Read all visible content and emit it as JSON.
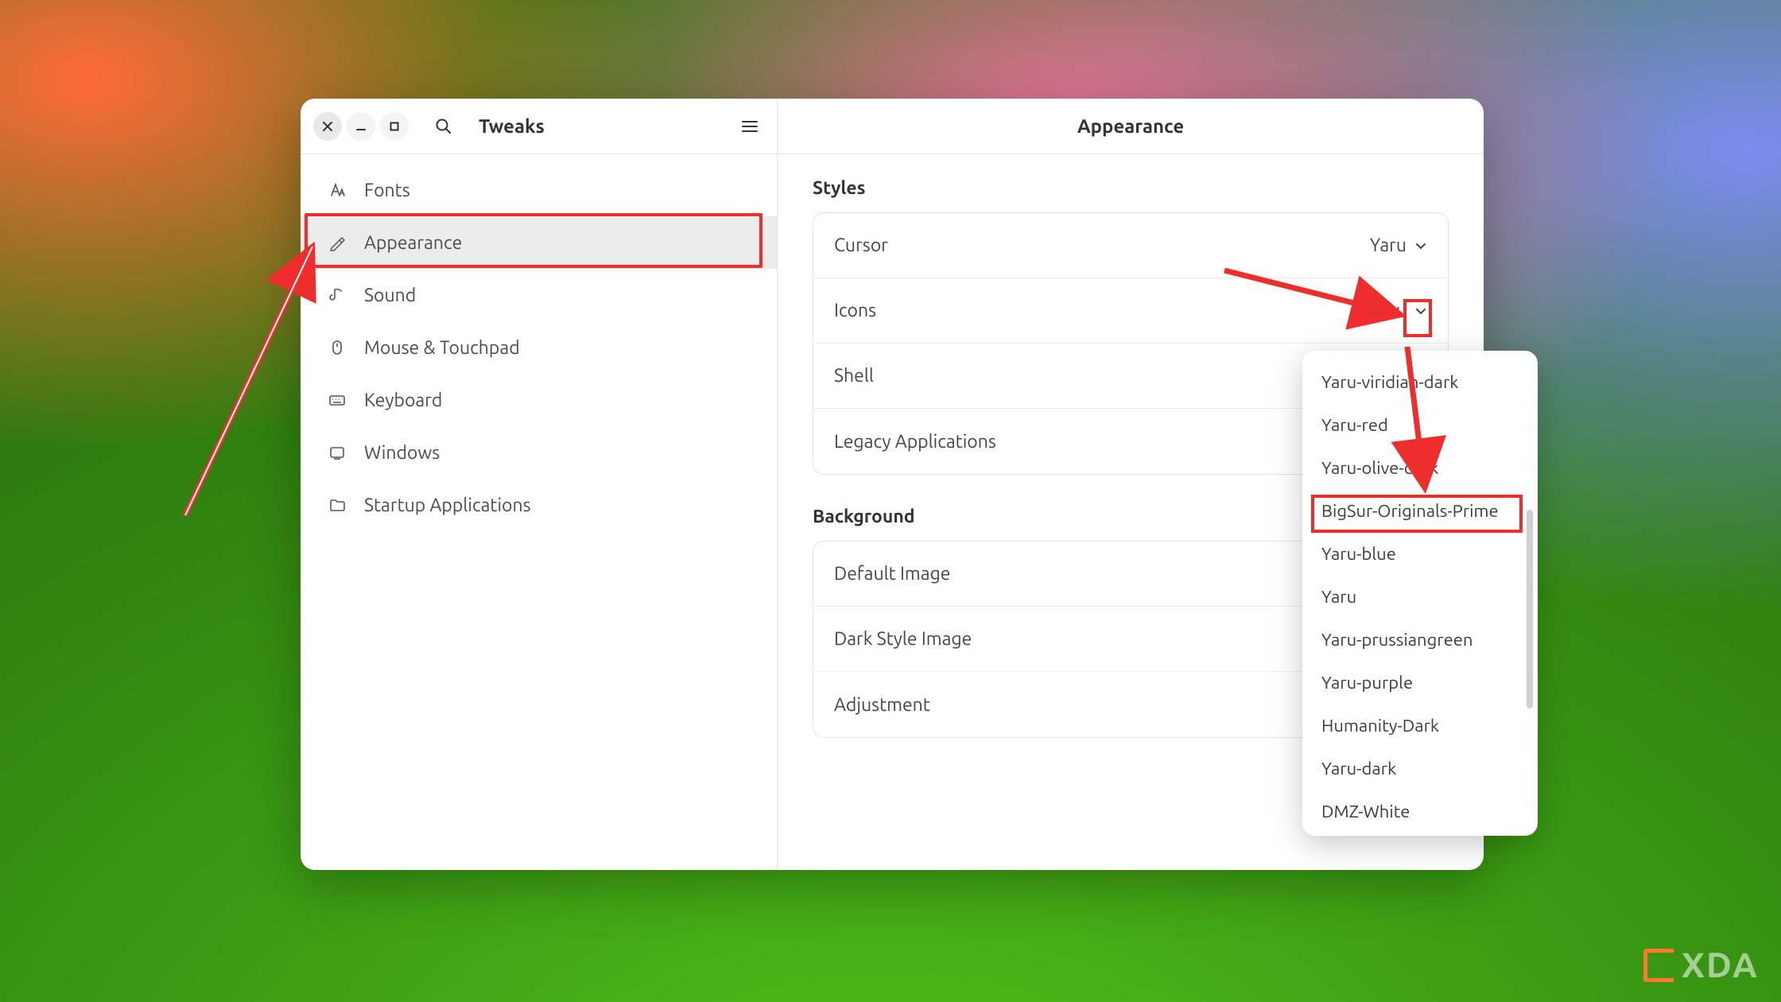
{
  "app_title": "Tweaks",
  "content_title": "Appearance",
  "sidebar": {
    "items": [
      {
        "label": "Fonts"
      },
      {
        "label": "Appearance"
      },
      {
        "label": "Sound"
      },
      {
        "label": "Mouse & Touchpad"
      },
      {
        "label": "Keyboard"
      },
      {
        "label": "Windows"
      },
      {
        "label": "Startup Applications"
      }
    ],
    "selected_index": 1
  },
  "sections": {
    "styles": {
      "title": "Styles",
      "rows": [
        {
          "label": "Cursor",
          "value": "Yaru"
        },
        {
          "label": "Icons",
          "value": "Yaru"
        },
        {
          "label": "Shell",
          "value": ""
        },
        {
          "label": "Legacy Applications",
          "value": ""
        }
      ]
    },
    "background": {
      "title": "Background",
      "rows": [
        {
          "label": "Default Image"
        },
        {
          "label": "Dark Style Image"
        },
        {
          "label": "Adjustment"
        }
      ]
    }
  },
  "dropdown": {
    "items": [
      "Yaru-viridian-dark",
      "Yaru-red",
      "Yaru-olive-dark",
      "BigSur-Originals-Prime",
      "Yaru-blue",
      "Yaru",
      "Yaru-prussiangreen",
      "Yaru-purple",
      "Humanity-Dark",
      "Yaru-dark",
      "DMZ-White"
    ],
    "highlighted_index": 3
  },
  "annotations": {
    "highlight_color": "#ee2d2d"
  },
  "watermark": "XDA"
}
